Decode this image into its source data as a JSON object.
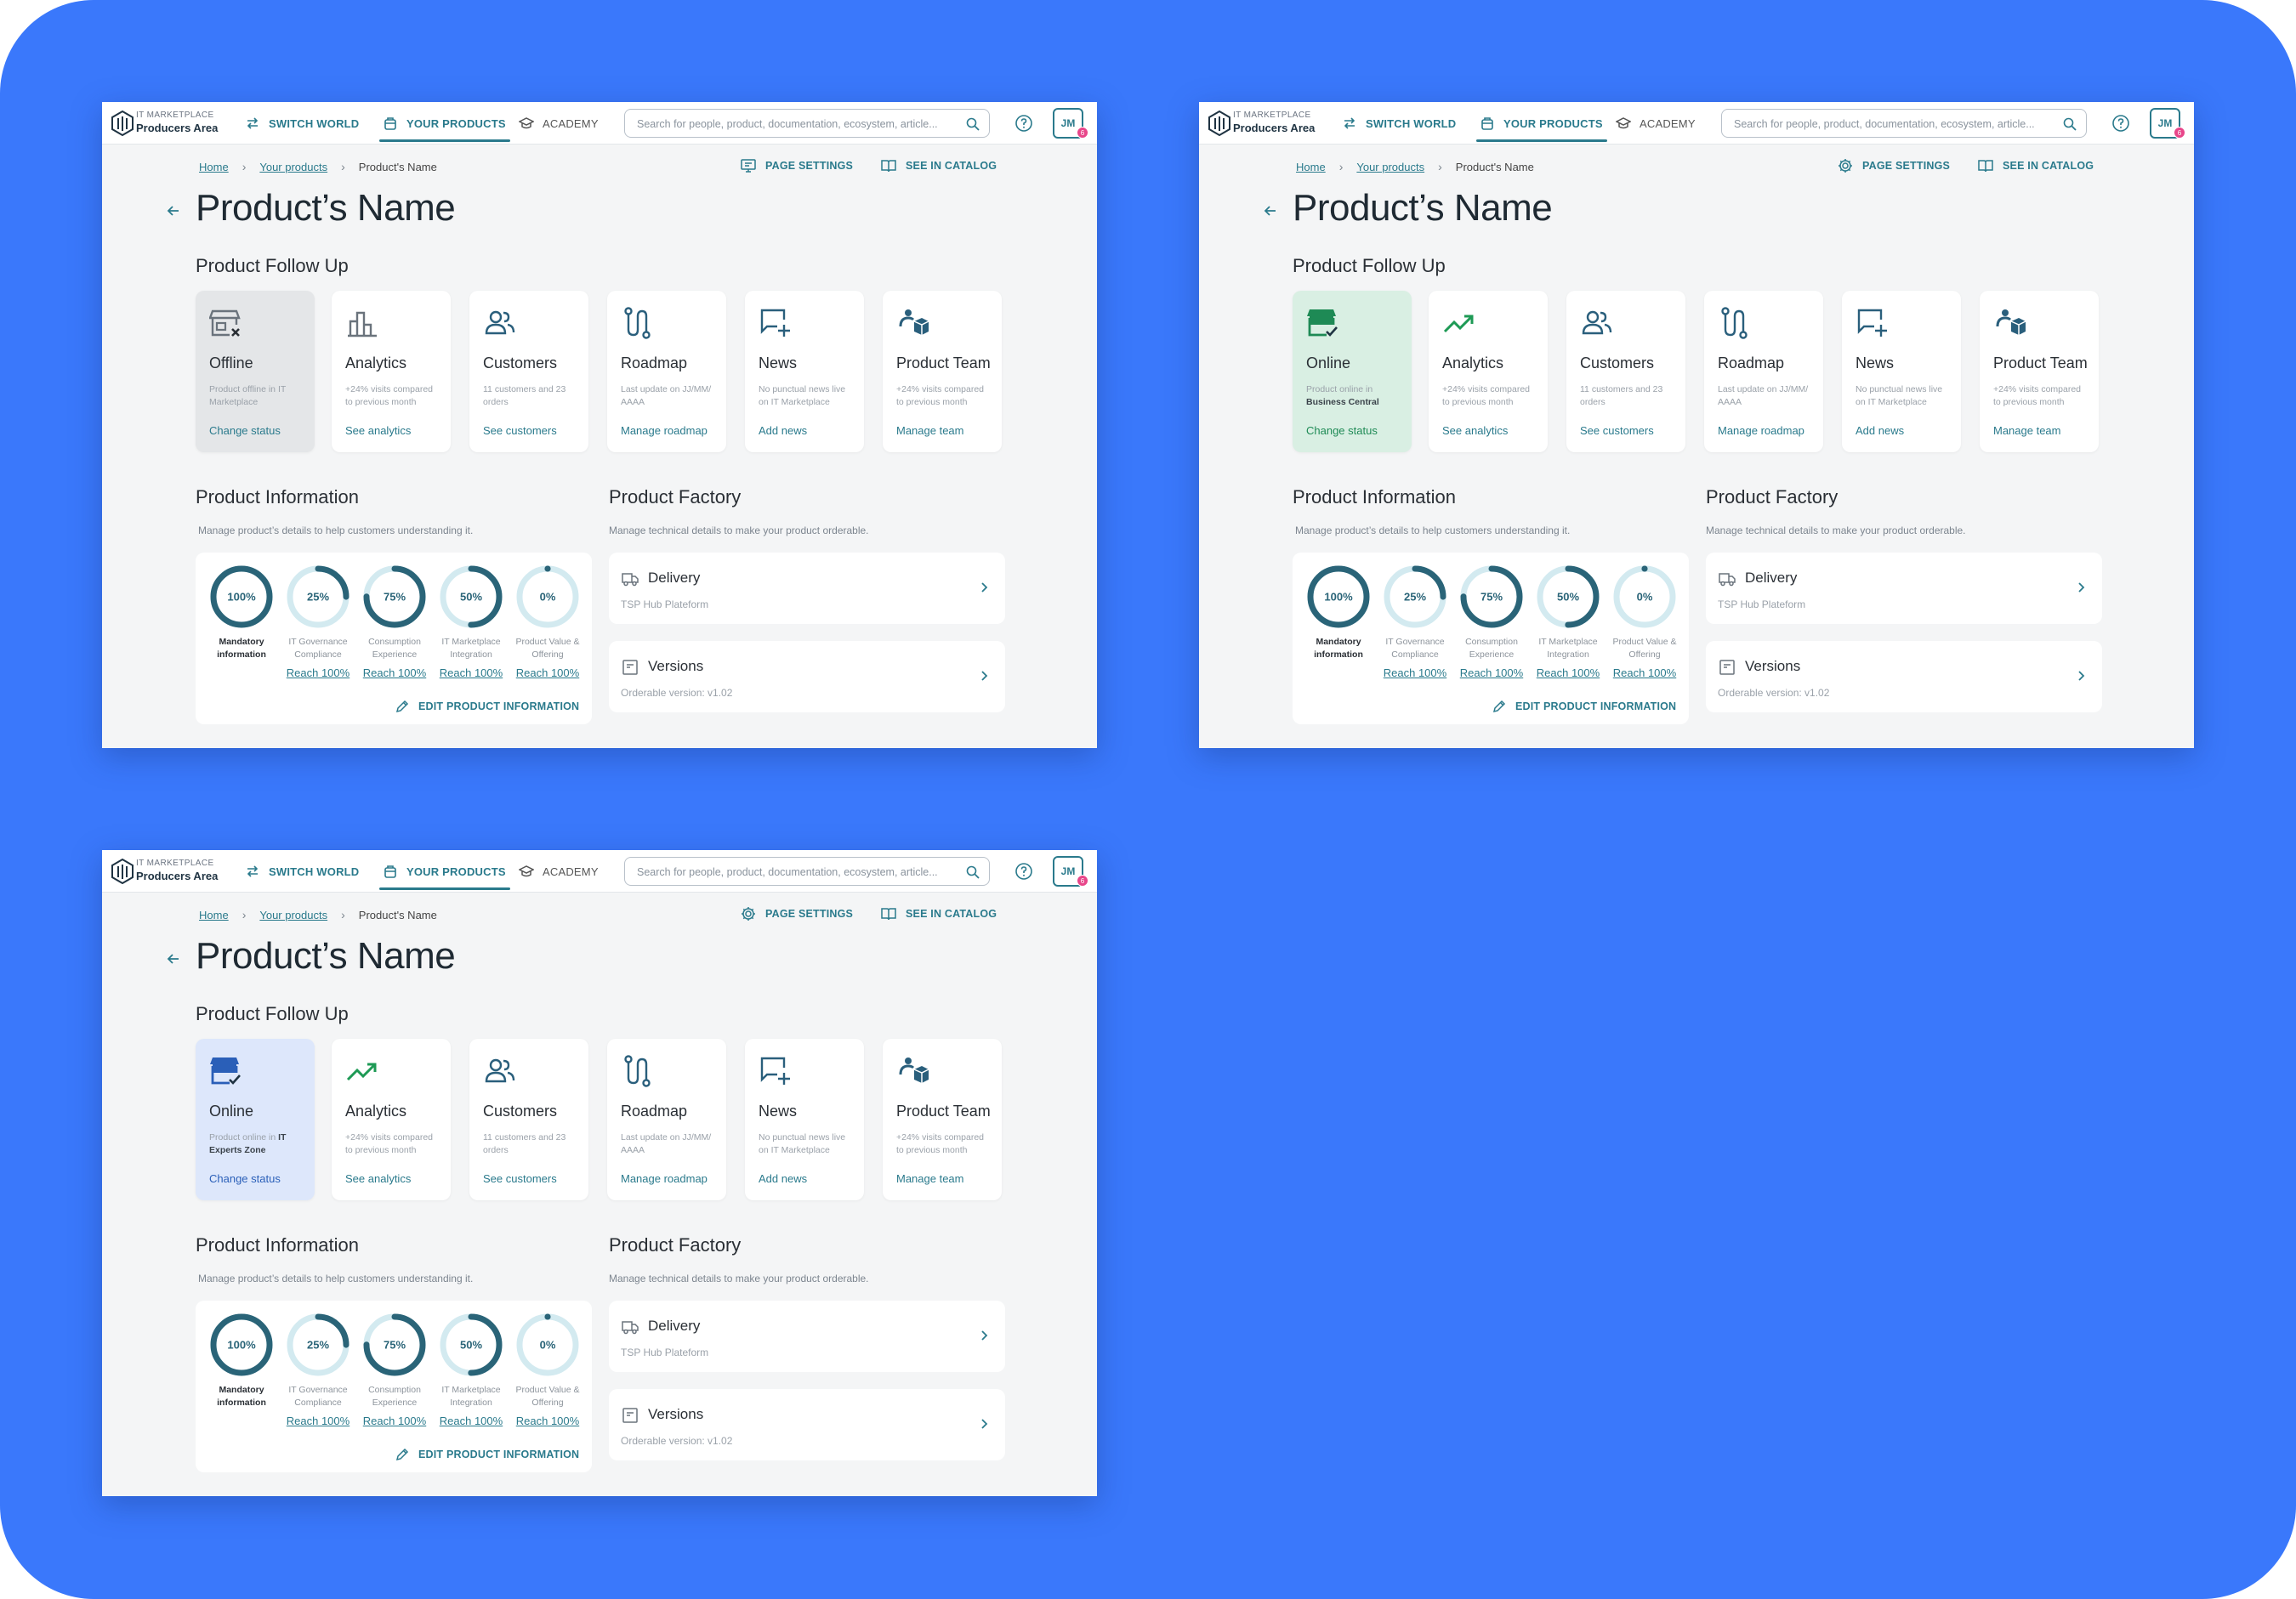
{
  "header": {
    "logo_small": "IT MARKETPLACE",
    "logo_big": "Producers Area",
    "switch_world": "SWITCH WORLD",
    "your_products": "YOUR PRODUCTS",
    "academy": "ACADEMY",
    "search_placeholder": "Search for people, product, documentation, ecosystem, article...",
    "avatar_initials": "JM",
    "avatar_badge": "6"
  },
  "breadcrumb": {
    "home": "Home",
    "products": "Your products",
    "current": "Product's Name"
  },
  "page_actions": {
    "settings": "PAGE SETTINGS",
    "catalog": "SEE IN CATALOG"
  },
  "page_title": "Product’s Name",
  "follow_up": {
    "title": "Product Follow Up",
    "cards": {
      "analytics": {
        "title": "Analytics",
        "desc": "+24% visits compared to previous month",
        "link": "See analytics"
      },
      "customers": {
        "title": "Customers",
        "desc": "11 customers and 23 orders",
        "link": "See customers"
      },
      "roadmap": {
        "title": "Roadmap",
        "desc": "Last update on JJ/MM/ AAAA",
        "link": "Manage roadmap"
      },
      "news": {
        "title": "News",
        "desc": "No punctual news live on IT Marketplace",
        "link": "Add news"
      },
      "team": {
        "title": "Product Team",
        "desc": "+24% visits compared to previous month",
        "link": "Manage team"
      }
    }
  },
  "variants": [
    {
      "status_class": "status-offline",
      "status_icon": "store-offline-icon",
      "status_title": "Offline",
      "status_desc_prefix": "Product offline in IT Marketplace",
      "status_desc_strong": "",
      "status_link": "Change status",
      "analytics_icon": "bar-chart-icon",
      "settings_icon": "monitor-settings-icon"
    },
    {
      "status_class": "status-green",
      "status_icon": "store-online-icon",
      "status_title": "Online",
      "status_desc_prefix": "Product online in",
      "status_desc_strong": "Business Central",
      "status_link": "Change status",
      "analytics_icon": "trending-up-icon",
      "settings_icon": "gear-icon"
    },
    {
      "status_class": "status-blue",
      "status_icon": "store-online-icon",
      "status_title": "Online",
      "status_desc_prefix": "Product online in",
      "status_desc_strong": "IT Experts Zone",
      "status_link": "Change status",
      "analytics_icon": "trending-up-icon",
      "settings_icon": "gear-icon"
    }
  ],
  "product_information": {
    "title": "Product Information",
    "subtitle": "Manage product’s details to help customers understanding it.",
    "gauges": [
      {
        "value": 100,
        "label": "100%",
        "caption": "Mandatory information",
        "main": true,
        "link": ""
      },
      {
        "value": 25,
        "label": "25%",
        "caption": "IT Governance Compliance",
        "main": false,
        "link": "Reach 100%"
      },
      {
        "value": 75,
        "label": "75%",
        "caption": "Consumption Experience",
        "main": false,
        "link": "Reach 100%"
      },
      {
        "value": 50,
        "label": "50%",
        "caption": "IT Marketplace Integration",
        "main": false,
        "link": "Reach 100%"
      },
      {
        "value": 0,
        "label": "0%",
        "caption": "Product Value & Offering",
        "main": false,
        "link": "Reach 100%"
      }
    ],
    "edit_label": "EDIT PRODUCT INFORMATION"
  },
  "product_factory": {
    "title": "Product Factory",
    "subtitle": "Manage technical details to make your product orderable.",
    "delivery": {
      "title": "Delivery",
      "sub": "TSP Hub Plateform"
    },
    "versions": {
      "title": "Versions",
      "sub": "Orderable version: v1.02"
    }
  },
  "colors": {
    "background": "#3a78fb",
    "accent": "#2a7a8c",
    "online_green": "#1e8a55",
    "online_blue": "#2a5fb8",
    "badge": "#e8468a"
  }
}
